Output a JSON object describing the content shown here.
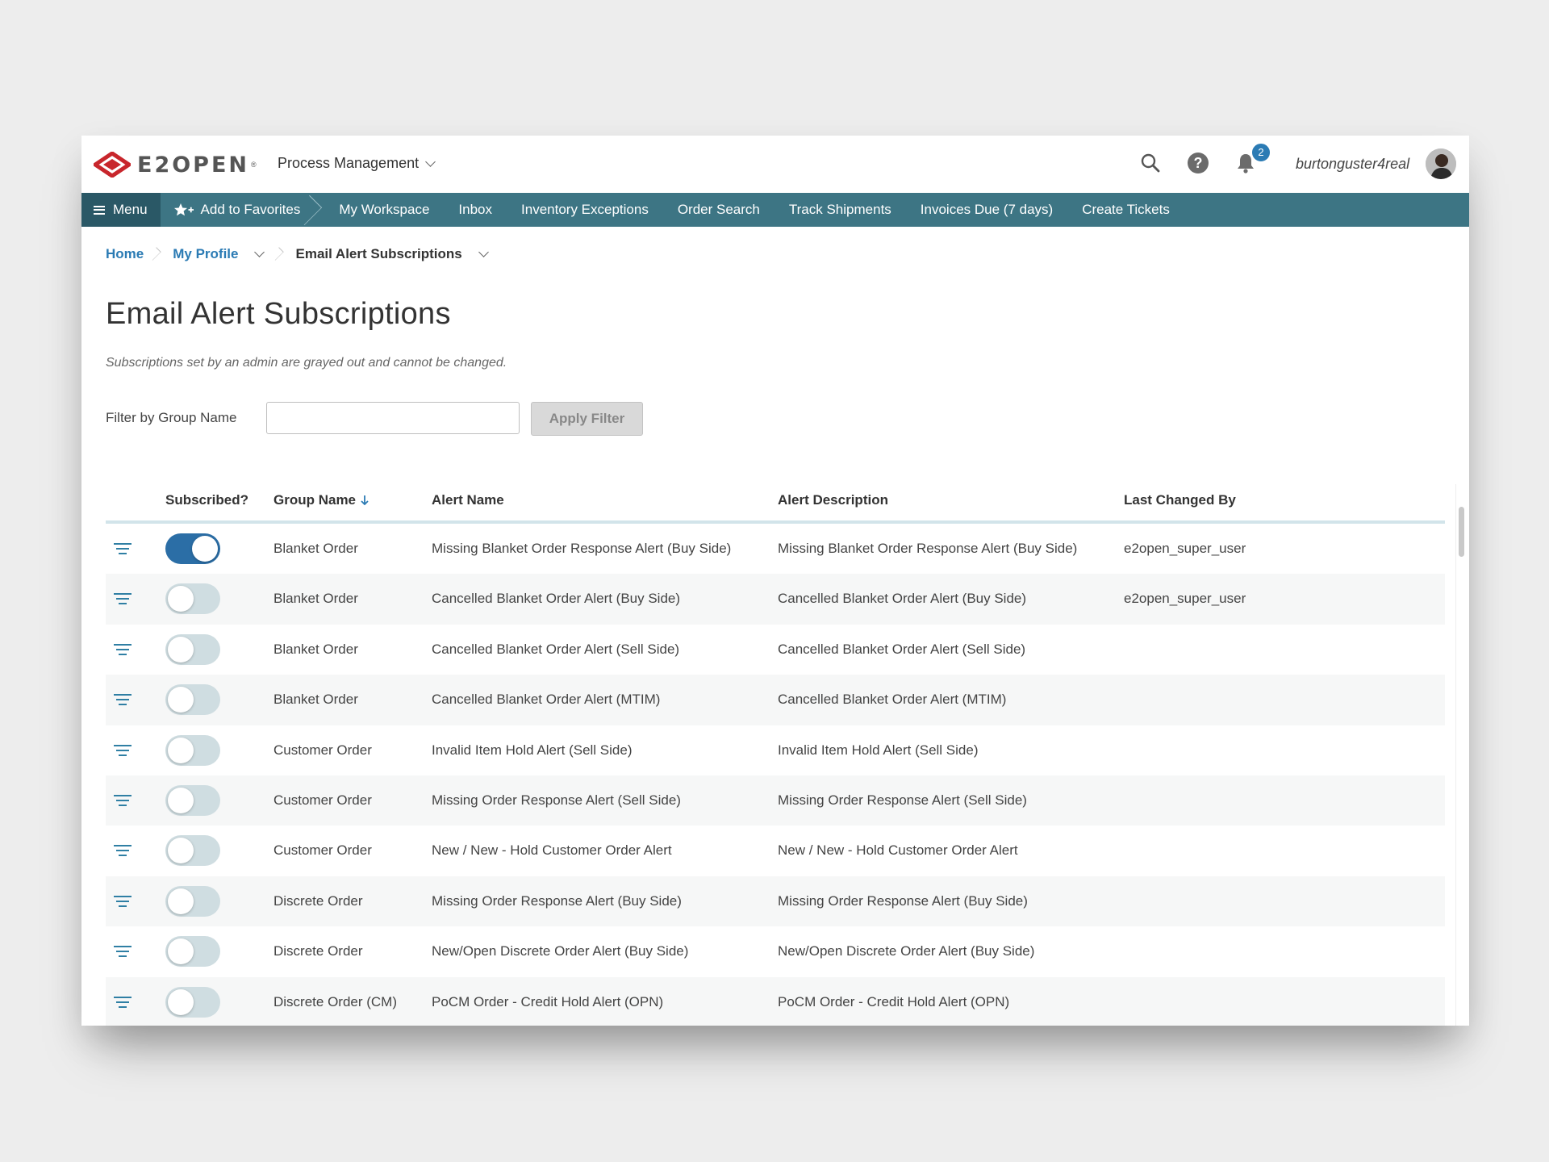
{
  "header": {
    "brand": "E2OPEN",
    "module": "Process Management",
    "notification_count": "2",
    "username": "burtonguster4real",
    "icons": [
      "search-icon",
      "help-icon",
      "bell-icon"
    ]
  },
  "nav": {
    "menu_label": "Menu",
    "favorites_label": "Add to Favorites",
    "items": [
      "My Workspace",
      "Inbox",
      "Inventory Exceptions",
      "Order Search",
      "Track Shipments",
      "Invoices Due (7 days)",
      "Create Tickets"
    ]
  },
  "breadcrumb": {
    "home": "Home",
    "profile": "My Profile",
    "current": "Email Alert Subscriptions"
  },
  "page": {
    "title": "Email Alert Subscriptions",
    "note": "Subscriptions set by an admin are grayed out and cannot be changed."
  },
  "filter": {
    "label": "Filter by Group Name",
    "value": "",
    "placeholder": "",
    "button": "Apply Filter"
  },
  "table": {
    "columns": [
      "Subscribed?",
      "Group Name",
      "Alert Name",
      "Alert Description",
      "Last Changed By"
    ],
    "sort_column": "Group Name",
    "rows": [
      {
        "subscribed": true,
        "group": "Blanket Order",
        "alert": "Missing Blanket Order Response Alert (Buy Side)",
        "description": "Missing Blanket Order Response Alert (Buy Side)",
        "changed_by": "e2open_super_user"
      },
      {
        "subscribed": false,
        "group": "Blanket Order",
        "alert": "Cancelled Blanket Order Alert (Buy Side)",
        "description": "Cancelled Blanket Order Alert (Buy Side)",
        "changed_by": "e2open_super_user"
      },
      {
        "subscribed": false,
        "group": "Blanket Order",
        "alert": "Cancelled Blanket Order Alert (Sell Side)",
        "description": "Cancelled Blanket Order Alert (Sell Side)",
        "changed_by": ""
      },
      {
        "subscribed": false,
        "group": "Blanket Order",
        "alert": "Cancelled Blanket Order Alert (MTIM)",
        "description": "Cancelled Blanket Order Alert (MTIM)",
        "changed_by": ""
      },
      {
        "subscribed": false,
        "group": "Customer Order",
        "alert": "Invalid Item Hold Alert (Sell Side)",
        "description": "Invalid Item Hold Alert (Sell Side)",
        "changed_by": ""
      },
      {
        "subscribed": false,
        "group": "Customer Order",
        "alert": "Missing Order Response Alert (Sell Side)",
        "description": "Missing Order Response Alert (Sell Side)",
        "changed_by": ""
      },
      {
        "subscribed": false,
        "group": "Customer Order",
        "alert": "New / New - Hold Customer Order Alert",
        "description": "New / New - Hold Customer Order Alert",
        "changed_by": ""
      },
      {
        "subscribed": false,
        "group": "Discrete Order",
        "alert": "Missing Order Response Alert (Buy Side)",
        "description": "Missing Order Response Alert (Buy Side)",
        "changed_by": ""
      },
      {
        "subscribed": false,
        "group": "Discrete Order",
        "alert": "New/Open Discrete Order Alert (Buy Side)",
        "description": "New/Open Discrete Order Alert (Buy Side)",
        "changed_by": ""
      },
      {
        "subscribed": false,
        "group": "Discrete Order (CM)",
        "alert": "PoCM Order - Credit Hold Alert (OPN)",
        "description": "PoCM Order - Credit Hold Alert (OPN)",
        "changed_by": ""
      }
    ]
  },
  "colors": {
    "brand_red": "#c8262c",
    "nav_bg": "#3d7584",
    "menu_bg": "#2a5866",
    "link": "#2b7bb4",
    "toggle_on": "#2b6ea6",
    "toggle_off": "#cfdde1"
  }
}
